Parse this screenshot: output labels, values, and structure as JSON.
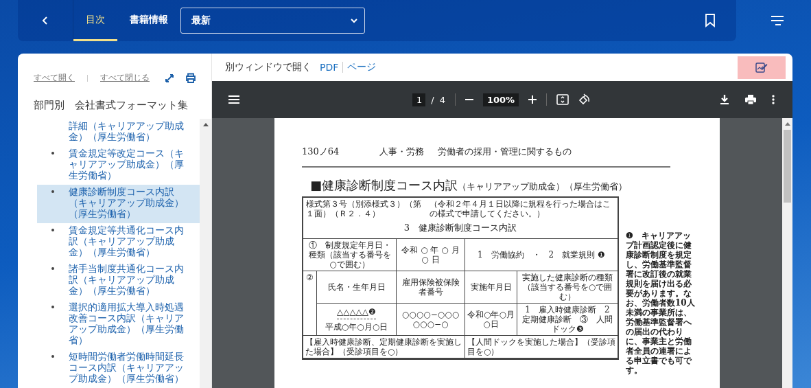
{
  "top_bar": {
    "tabs": [
      {
        "label": "目次",
        "selected": true
      },
      {
        "label": "書籍情報",
        "selected": false
      }
    ],
    "edition_select": {
      "value": "最新"
    }
  },
  "sidebar": {
    "expand_all": "すべて開く",
    "collapse_all": "すべて閉じる",
    "book_title": "部門別　会社書式フォーマット集",
    "items": [
      {
        "kind": "continuation",
        "label": "詳細（キャリアアップ助成金）（厚生労働省）",
        "selected": false
      },
      {
        "kind": "entry",
        "label": "賃金規定等改定コース（キャリアアップ助成金）（厚生労働省）",
        "selected": false
      },
      {
        "kind": "entry",
        "label": "健康診断制度コース内訳（キャリアアップ助成金）（厚生労働省）",
        "selected": true
      },
      {
        "kind": "entry",
        "label": "賃金規定等共通化コース内訳（キャリアアップ助成金）（厚生労働省）",
        "selected": false
      },
      {
        "kind": "entry",
        "label": "諸手当制度共通化コース内訳（キャリアアップ助成金）（厚生労働省）",
        "selected": false
      },
      {
        "kind": "entry",
        "label": "選択的適用拡大導入時処遇改善コース内訳（キャリアアップ助成金）（厚生労働省）",
        "selected": false
      },
      {
        "kind": "entry",
        "label": "短時間労働者労働時間延長コース内訳（キャリアアップ助成金）（厚生労働省）",
        "selected": false
      }
    ]
  },
  "viewer": {
    "open_window": "別ウィンドウで開く",
    "links": [
      "PDF",
      "ページ"
    ],
    "page_current": "1",
    "page_sep": "/",
    "page_total": "4",
    "zoom": "100%"
  },
  "document": {
    "page_no": "130ノ64",
    "section": "人事・労務",
    "topic": "労働者の採用・管理に関するもの",
    "title": "■健康診断制度コース内訳",
    "subtitle": "（キャリアアップ助成金）（厚生労働省）",
    "form": {
      "form_no": "様式第３号（別添様式３）（第１面）（Ｒ２．４）",
      "notice": "（令和２年４月１日以降に規程を行った場合はこの様式で申請してください。）",
      "heading": "3　健康診断制度コース内訳",
      "rule_label": "①　制度規定年月日・種類（該当する番号を○で囲む）",
      "rule_date": "令和 ○ 年 ○ 月 ○ 日",
      "rule_type": "1　労働協約　・　2　就業規則 ❶",
      "section_no": "②",
      "headers": [
        "氏名・生年月日",
        "雇用保険被保険者番号",
        "実施年月日",
        "実施した健康診断の種類（該当する番号を○で囲む）"
      ],
      "name": "△△△△△❷",
      "birth": "平成○年○月○日",
      "insured_no": "○○○○−○○○○○○−○",
      "exam_date": "令和○年○月○日",
      "exam_kinds": "1　雇入時健康診断　2　定期健康診断　③　人間ドック❸",
      "left_heading": "【雇入時健康診断、定期健康診断を実施した場合】（受診項目を○）",
      "right_heading": "【人間ドックを実施した場合】（受診項目を○）"
    },
    "note": "❶　キャリアアップ計画認定後に健康診断制度を規定し、労働基準監督署に改訂後の就業規則を届け出る必要があります。なお、労働者数10人未満の事業所は、労働基準監督署への届出の代わりに、事業主と労働者全員の連署による申立書でも可です。"
  }
}
